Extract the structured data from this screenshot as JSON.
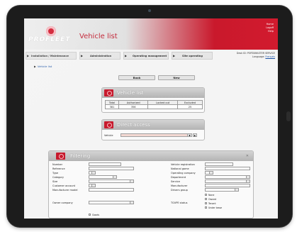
{
  "app": {
    "logo_text": "PROFLEET",
    "page_title": "Vehicle list",
    "header_links": [
      "Home",
      "Logoff",
      "Help"
    ]
  },
  "nav": {
    "items": [
      {
        "label": "Installation / Maintenance"
      },
      {
        "label": "Administration"
      },
      {
        "label": "Operating management"
      },
      {
        "label": "Site operating"
      }
    ],
    "user_info": "Desk ID: PORTAMASTER SERVICE",
    "language_label": "Language:",
    "language_value": "Français"
  },
  "breadcrumb": "Vehicle list",
  "buttons": {
    "book": "Book",
    "new": "New"
  },
  "vehicle_list": {
    "title": "Vehicle list",
    "columns": [
      "Total",
      "Authorized",
      "Locked out",
      "Excluded"
    ],
    "values": [
      "381",
      "356",
      "",
      "25"
    ]
  },
  "direct_access": {
    "title": "Direct access",
    "vehicle_label": "Vehicle",
    "vehicle_value": ""
  },
  "filtering": {
    "title": "Filtering",
    "close": "✕",
    "left_labels": [
      "Number",
      "Reference",
      "Type",
      "Category",
      "Size",
      "Customer account",
      "Manufacturer model",
      "Owner company"
    ],
    "right_labels": [
      "Vehicle registration",
      "National game",
      "Operating company",
      "Department",
      "Service",
      "Manufacturer",
      "Drivers group",
      "TGVPE status"
    ],
    "status_options": [
      "None",
      "Owned",
      "Tenant",
      "Under lease"
    ],
    "bottom_checkbox_label": "Goods"
  }
}
